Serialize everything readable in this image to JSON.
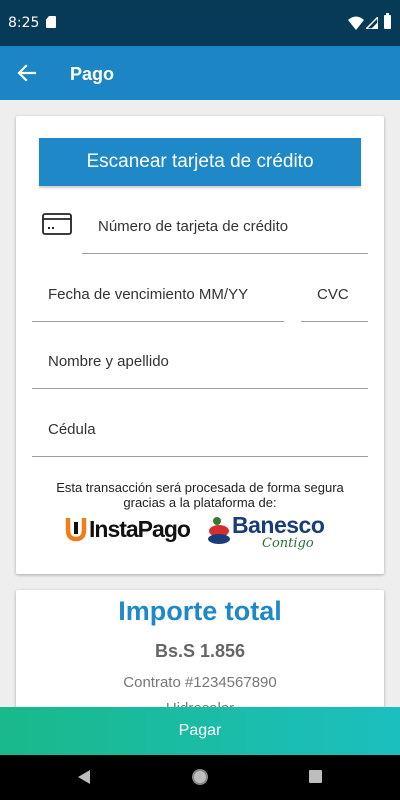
{
  "status_bar": {
    "time": "8:25"
  },
  "app_bar": {
    "title": "Pago"
  },
  "form": {
    "scan_button_label": "Escanear tarjeta de crédito",
    "card_number_placeholder": "Número de tarjeta de crédito",
    "expiry_placeholder": "Fecha de vencimiento MM/YY",
    "cvc_placeholder": "CVC",
    "name_placeholder": "Nombre y apellido",
    "id_placeholder": "Cédula",
    "secure_text_line1": "Esta transacción será procesada de forma segura",
    "secure_text_line2": "gracias a la plataforma de:",
    "instapago_logo_text": "InstaPago",
    "banesco_logo_text": "Banesco",
    "banesco_tagline": "Contigo"
  },
  "total": {
    "title": "Importe total",
    "amount": "Bs.S 1.856",
    "contract": "Contrato #1234567890",
    "partial_text": "Hidrocolor"
  },
  "pay_button_label": "Pagar",
  "colors": {
    "status_bar": "#063a57",
    "app_bar": "#1b85c5",
    "primary": "#1f88c9",
    "pay_button_start": "#19b98a",
    "pay_button_end": "#1cbfbf",
    "instapago_orange": "#f07d1a",
    "banesco_blue": "#1a3c7a",
    "banesco_red": "#d32f2f",
    "banesco_green": "#2f6e3a"
  },
  "icons": {
    "back": "arrow-left-icon",
    "card": "credit-card-icon",
    "wifi": "wifi-icon",
    "signal": "signal-icon",
    "battery": "battery-icon",
    "sd": "sd-card-icon"
  }
}
